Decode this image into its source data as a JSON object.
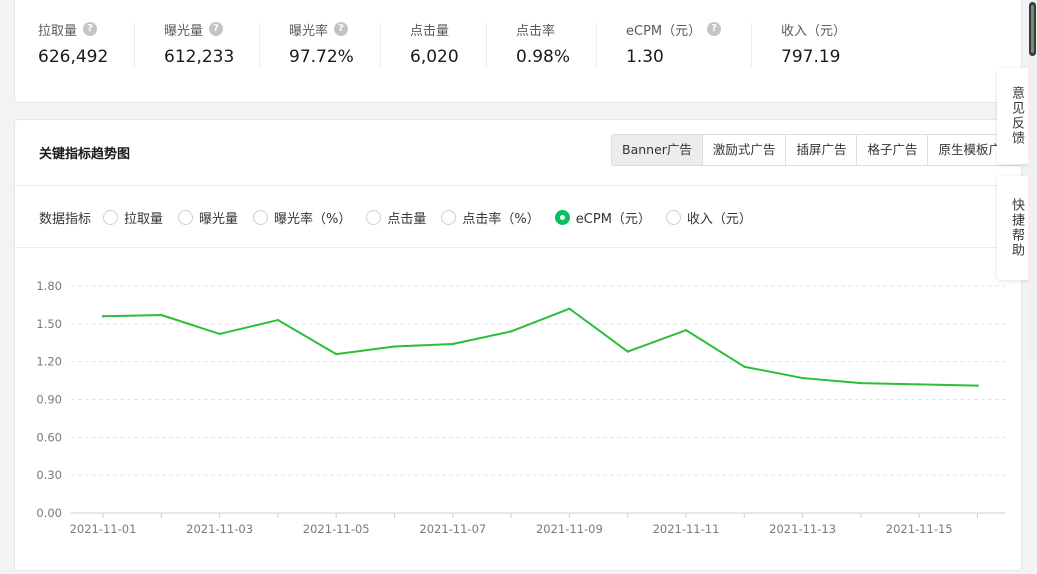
{
  "stats": [
    {
      "label": "拉取量",
      "value": "626,492",
      "help": true
    },
    {
      "label": "曝光量",
      "value": "612,233",
      "help": true
    },
    {
      "label": "曝光率",
      "value": "97.72%",
      "help": true
    },
    {
      "label": "点击量",
      "value": "6,020",
      "help": false
    },
    {
      "label": "点击率",
      "value": "0.98%",
      "help": false
    },
    {
      "label": "eCPM（元）",
      "value": "1.30",
      "help": true
    },
    {
      "label": "收入（元）",
      "value": "797.19",
      "help": false
    }
  ],
  "chart_section": {
    "title": "关键指标趋势图",
    "tabs": [
      "Banner广告",
      "激励式广告",
      "插屏广告",
      "格子广告",
      "原生模板广告"
    ],
    "active_tab": "Banner广告",
    "metrics_label": "数据指标",
    "metrics": [
      "拉取量",
      "曝光量",
      "曝光率（%）",
      "点击量",
      "点击率（%）",
      "eCPM（元）",
      "收入（元）"
    ],
    "selected_metric": "eCPM（元）"
  },
  "floating": {
    "feedback": "意见反馈",
    "help": "快捷帮助"
  },
  "chart_data": {
    "type": "line",
    "x": [
      "2021-11-01",
      "2021-11-02",
      "2021-11-03",
      "2021-11-04",
      "2021-11-05",
      "2021-11-06",
      "2021-11-07",
      "2021-11-08",
      "2021-11-09",
      "2021-11-10",
      "2021-11-11",
      "2021-11-12",
      "2021-11-13",
      "2021-11-14",
      "2021-11-15",
      "2021-11-16"
    ],
    "x_tick_labels": [
      "2021-11-01",
      "2021-11-03",
      "2021-11-05",
      "2021-11-07",
      "2021-11-09",
      "2021-11-11",
      "2021-11-13",
      "2021-11-15"
    ],
    "series": [
      {
        "values": [
          1.56,
          1.57,
          1.42,
          1.53,
          1.26,
          1.32,
          1.34,
          1.44,
          1.62,
          1.28,
          1.45,
          1.16,
          1.07,
          1.03,
          1.02,
          1.01
        ]
      }
    ],
    "ylim": [
      0,
      1.8
    ],
    "y_ticks": [
      "0.00",
      "0.30",
      "0.60",
      "0.90",
      "1.20",
      "1.50",
      "1.80"
    ],
    "grid": true,
    "line_color": "#2bbf38"
  }
}
